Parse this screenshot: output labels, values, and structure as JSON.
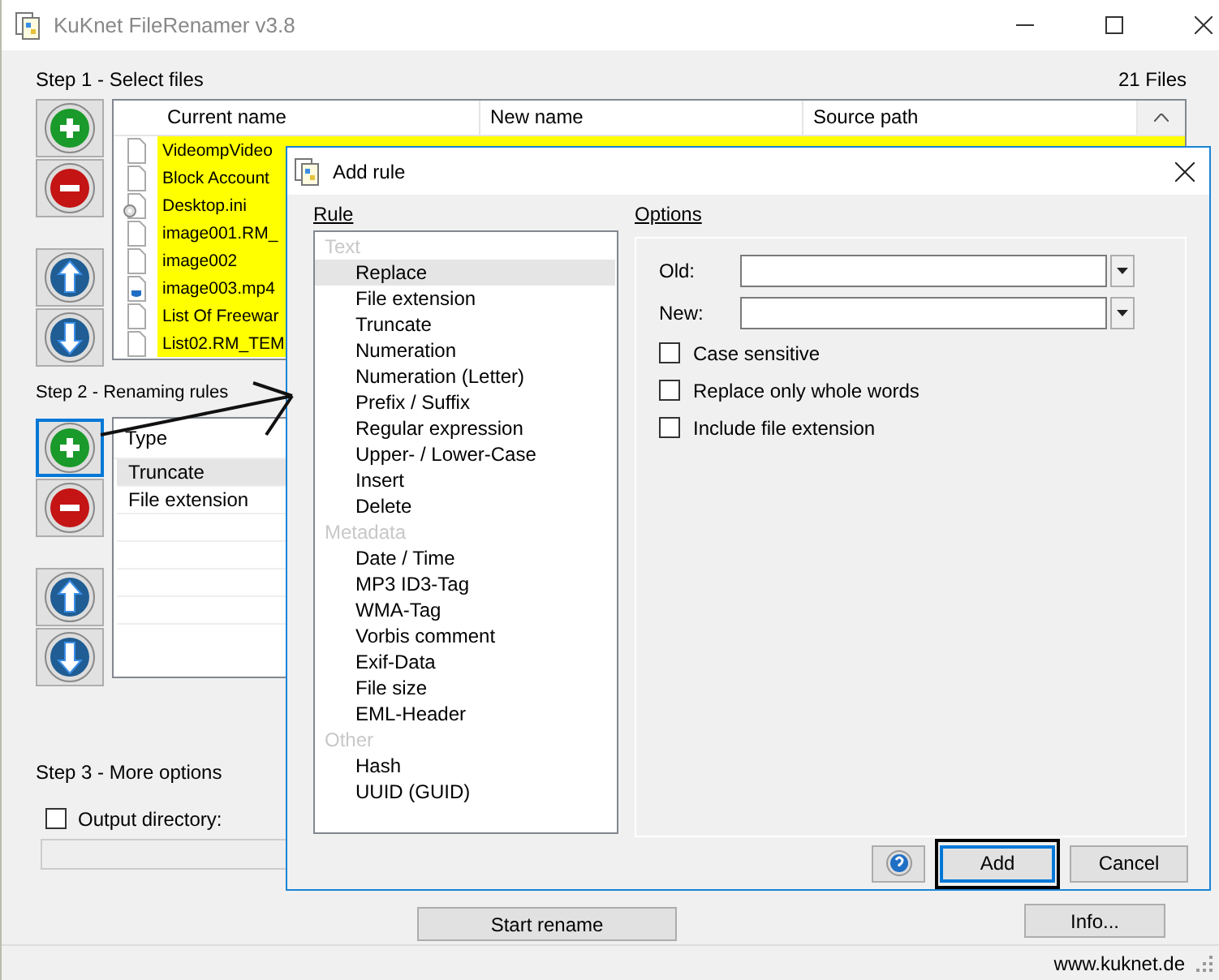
{
  "window": {
    "title": "KuKnet FileRenamer v3.8"
  },
  "step1": {
    "heading": "Step 1 - Select files",
    "file_count": "21 Files",
    "side_buttons": [
      {
        "kind": "add",
        "focused": false
      },
      {
        "kind": "remove",
        "focused": false
      },
      {
        "kind": "up",
        "focused": false
      },
      {
        "kind": "down",
        "focused": false
      }
    ],
    "columns": [
      "Current name",
      "New name",
      "Source path"
    ],
    "files": [
      {
        "name": "VideompVideo",
        "kind": "blank",
        "highlighted": true
      },
      {
        "name": "Block Account",
        "kind": "blank",
        "highlighted": true
      },
      {
        "name": "Desktop.ini",
        "kind": "settings",
        "highlighted": true
      },
      {
        "name": "image001.RM_",
        "kind": "blank",
        "highlighted": true
      },
      {
        "name": "image002",
        "kind": "blank",
        "highlighted": true
      },
      {
        "name": "image003.mp4",
        "kind": "media",
        "highlighted": true
      },
      {
        "name": "List Of Freewar",
        "kind": "blank",
        "highlighted": true
      },
      {
        "name": "List02.RM_TEM",
        "kind": "blank",
        "highlighted": true
      }
    ]
  },
  "step2": {
    "heading": "Step 2 - Renaming rules",
    "side_buttons": [
      {
        "kind": "add",
        "focused": true
      },
      {
        "kind": "remove",
        "focused": false
      },
      {
        "kind": "up",
        "focused": false
      },
      {
        "kind": "down",
        "focused": false
      }
    ],
    "column": "Type",
    "rules": [
      {
        "label": "Truncate",
        "selected": true
      },
      {
        "label": "File extension",
        "selected": false
      }
    ]
  },
  "step3": {
    "heading": "Step 3 - More options",
    "output_directory": {
      "label": "Output directory:",
      "checked": false
    }
  },
  "buttons": [
    "Start rename",
    "Info..."
  ],
  "status_bar": {
    "link": "www.kuknet.de"
  },
  "dialog": {
    "title": "Add rule",
    "rule_label": "Rule",
    "groups": [
      {
        "label": "Text",
        "items": [
          {
            "label": "Replace",
            "selected": true
          },
          {
            "label": "File extension",
            "selected": false
          },
          {
            "label": "Truncate",
            "selected": false
          },
          {
            "label": "Numeration",
            "selected": false
          },
          {
            "label": "Numeration (Letter)",
            "selected": false
          },
          {
            "label": "Prefix / Suffix",
            "selected": false
          },
          {
            "label": "Regular expression",
            "selected": false
          },
          {
            "label": "Upper- / Lower-Case",
            "selected": false
          },
          {
            "label": "Insert",
            "selected": false
          },
          {
            "label": "Delete",
            "selected": false
          }
        ]
      },
      {
        "label": "Metadata",
        "items": [
          {
            "label": "Date / Time",
            "selected": false
          },
          {
            "label": "MP3 ID3-Tag",
            "selected": false
          },
          {
            "label": "WMA-Tag",
            "selected": false
          },
          {
            "label": "Vorbis comment",
            "selected": false
          },
          {
            "label": "Exif-Data",
            "selected": false
          },
          {
            "label": "File size",
            "selected": false
          },
          {
            "label": "EML-Header",
            "selected": false
          }
        ]
      },
      {
        "label": "Other",
        "items": [
          {
            "label": "Hash",
            "selected": false
          },
          {
            "label": "UUID (GUID)",
            "selected": false
          }
        ]
      }
    ],
    "options_label": "Options",
    "fields": [
      {
        "label": "Old:"
      },
      {
        "label": "New:"
      }
    ],
    "checkboxes": [
      {
        "label": "Case sensitive",
        "checked": false
      },
      {
        "label": "Replace only whole words",
        "checked": false
      },
      {
        "label": "Include file extension",
        "checked": false
      }
    ],
    "buttons": [
      {
        "kind": "help"
      },
      {
        "kind": "default",
        "label": "Add"
      },
      {
        "kind": "normal",
        "label": "Cancel"
      }
    ]
  }
}
